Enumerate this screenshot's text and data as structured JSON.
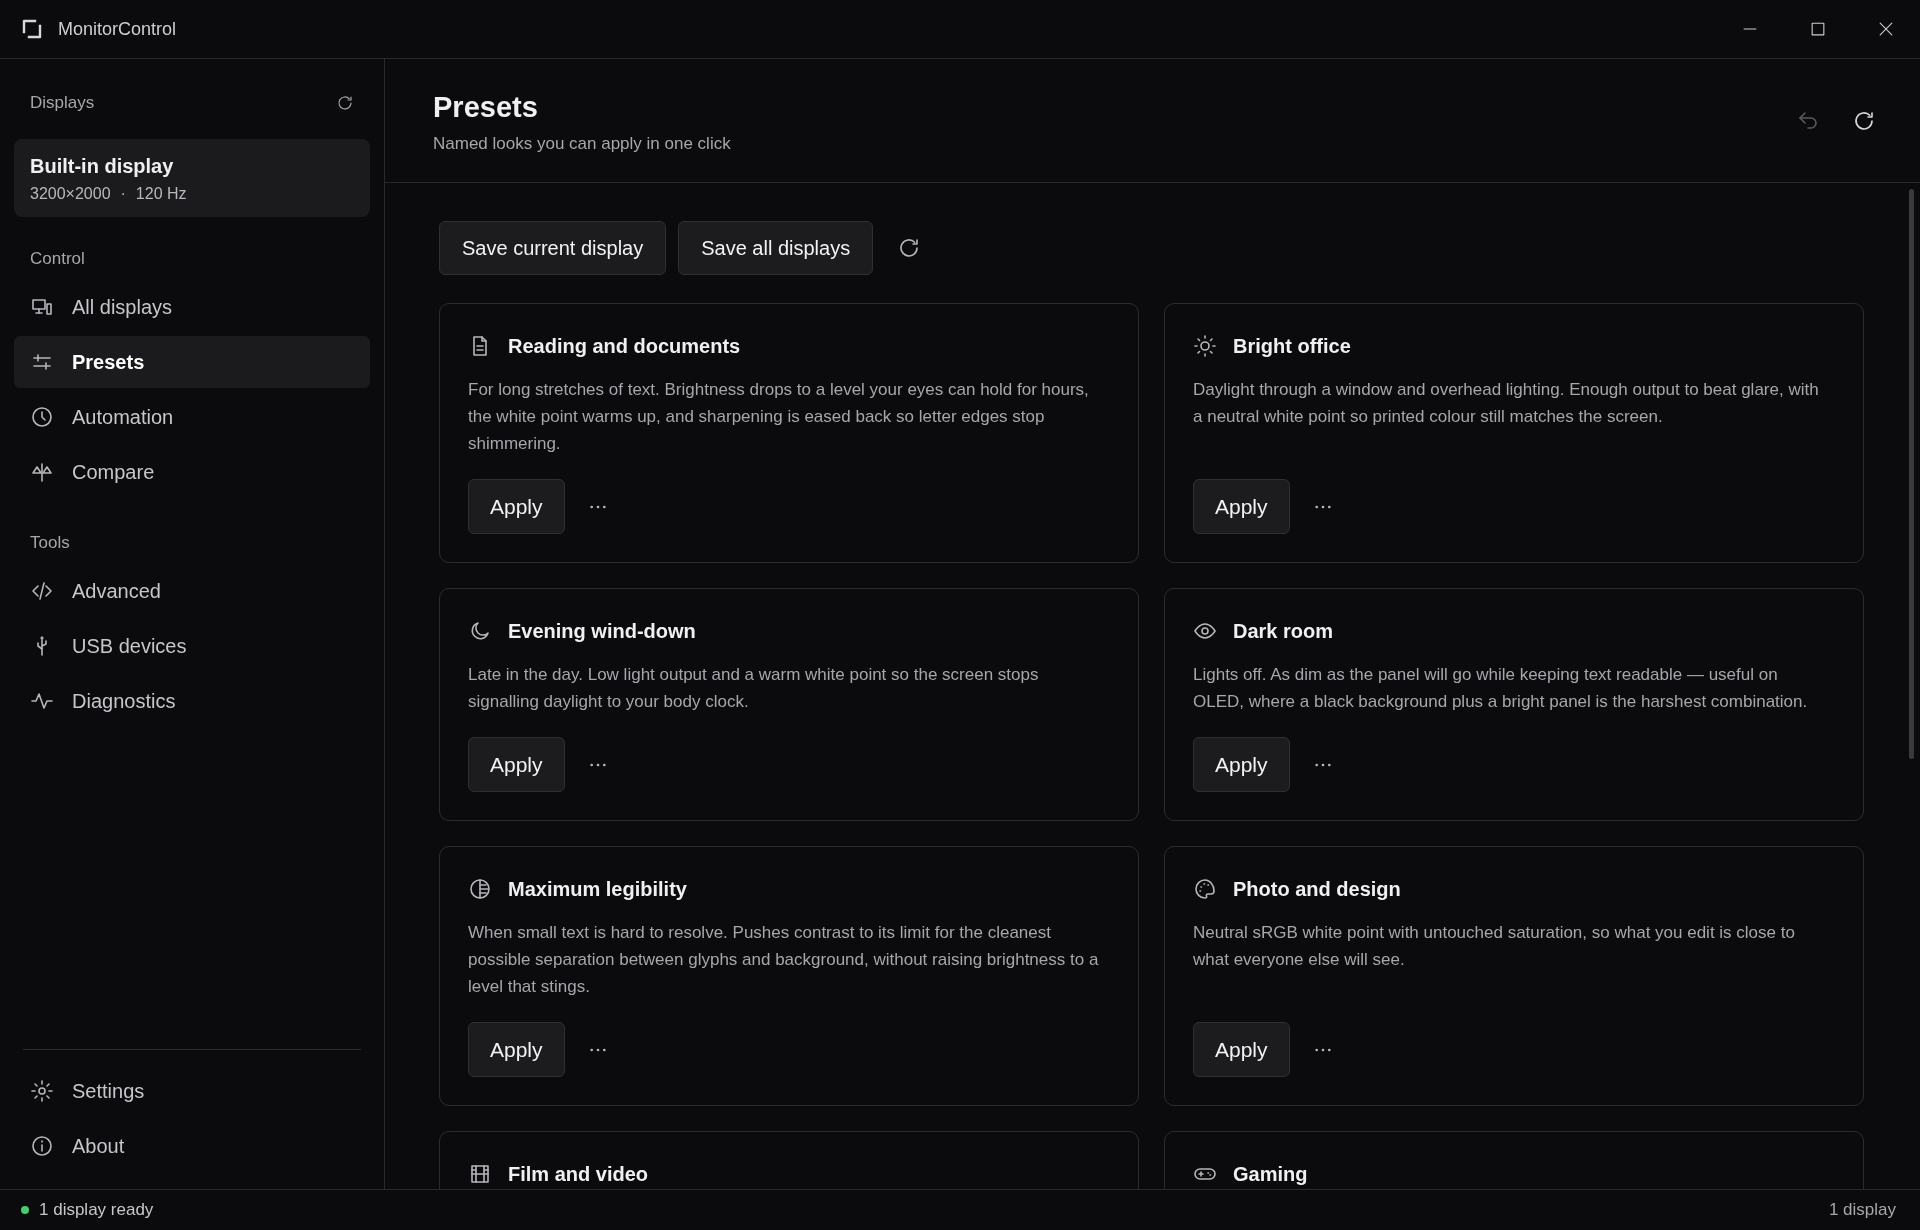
{
  "window": {
    "title": "MonitorControl"
  },
  "sidebar": {
    "displays_heading": "Displays",
    "display": {
      "name": "Built-in display",
      "resolution": "3200×2000",
      "separator": "·",
      "refresh": "120 Hz",
      "selected": true
    },
    "sections": [
      {
        "heading": "Control",
        "items": [
          {
            "label": "All displays",
            "kind": "displays",
            "selected": false
          },
          {
            "label": "Presets",
            "kind": "sliders",
            "selected": true
          },
          {
            "label": "Automation",
            "kind": "clock",
            "selected": false
          },
          {
            "label": "Compare",
            "kind": "compare",
            "selected": false
          }
        ]
      },
      {
        "heading": "Tools",
        "items": [
          {
            "label": "Advanced",
            "kind": "code",
            "selected": false
          },
          {
            "label": "USB devices",
            "kind": "usb",
            "selected": false
          },
          {
            "label": "Diagnostics",
            "kind": "pulse",
            "selected": false
          }
        ]
      }
    ],
    "footer_items": [
      {
        "label": "Settings",
        "kind": "gear",
        "selected": false
      },
      {
        "label": "About",
        "kind": "info",
        "selected": false
      }
    ]
  },
  "header": {
    "title": "Presets",
    "subtitle": "Named looks you can apply in one click",
    "actions": [
      {
        "kind": "undo",
        "disabled": true
      },
      {
        "kind": "refresh",
        "disabled": false
      }
    ]
  },
  "toolbar": {
    "buttons": [
      "Save current display",
      "Save all displays"
    ]
  },
  "presets": [
    {
      "kind": "document",
      "title": "Reading and documents",
      "description": "For long stretches of text. Brightness drops to a level your eyes can hold for hours, the white point warms up, and sharpening is eased back so letter edges stop shimmering.",
      "action": "Apply"
    },
    {
      "kind": "sun",
      "title": "Bright office",
      "description": "Daylight through a window and overhead lighting. Enough output to beat glare, with a neutral white point so printed colour still matches the screen.",
      "action": "Apply"
    },
    {
      "kind": "moon",
      "title": "Evening wind-down",
      "description": "Late in the day. Low light output and a warm white point so the screen stops signalling daylight to your body clock.",
      "action": "Apply"
    },
    {
      "kind": "eye",
      "title": "Dark room",
      "description": "Lights off. As dim as the panel will go while keeping text readable — useful on OLED, where a black background plus a bright panel is the harshest combination.",
      "action": "Apply"
    },
    {
      "kind": "contrast",
      "title": "Maximum legibility",
      "description": "When small text is hard to resolve. Pushes contrast to its limit for the cleanest possible separation between glyphs and background, without raising brightness to a level that stings.",
      "action": "Apply"
    },
    {
      "kind": "palette",
      "title": "Photo and design",
      "description": "Neutral sRGB white point with untouched saturation, so what you edit is close to what everyone else will see.",
      "action": "Apply"
    },
    {
      "kind": "film",
      "title": "Film and video"
    },
    {
      "kind": "gamepad",
      "title": "Gaming"
    }
  ],
  "status_bar": {
    "message": "1 display ready",
    "count": "1 display"
  }
}
